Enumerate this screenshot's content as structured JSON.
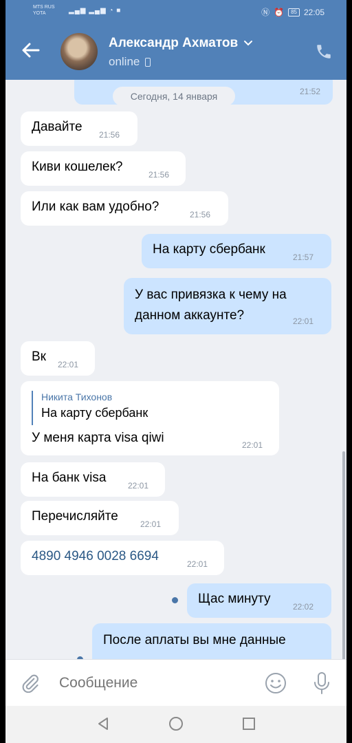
{
  "status_bar": {
    "carrier_line1": "MTS RUS",
    "carrier_line2": "YOTA",
    "battery": "85",
    "time": "22:05"
  },
  "header": {
    "contact_name": "Александр Ахматов",
    "status": "online",
    "accent_color": "#5181b8"
  },
  "date_separator": "Сегодня, 14 января",
  "top_partial_time": "21:52",
  "messages": [
    {
      "dir": "in",
      "text": "Давайте",
      "time": "21:56"
    },
    {
      "dir": "in",
      "text": "Киви кошелек?",
      "time": "21:56"
    },
    {
      "dir": "in",
      "text": "Или как вам удобно?",
      "time": "21:56"
    },
    {
      "dir": "out",
      "text": "На карту сбербанк",
      "time": "21:57"
    },
    {
      "dir": "out",
      "text_line1": "У вас привязка к чему  на",
      "text_line2": "данном аккаунте?",
      "time": "22:01"
    },
    {
      "dir": "in",
      "text": "Вк",
      "time": "22:01"
    },
    {
      "dir": "in",
      "reply_author": "Никита Тихонов",
      "reply_text": "На карту сбербанк",
      "text": "У меня карта visa qiwi",
      "time": "22:01"
    },
    {
      "dir": "in",
      "text": "На банк visa",
      "time": "22:01"
    },
    {
      "dir": "in",
      "text": "Перечисляйте",
      "time": "22:01"
    },
    {
      "dir": "in",
      "text": "4890 4946 0028 6694",
      "time": "22:01",
      "link_color": "#2a5885"
    },
    {
      "dir": "out",
      "text": "Щас минуту",
      "time": "22:02",
      "unread_dot": true
    },
    {
      "dir": "out",
      "text": "После аплаты вы мне данные",
      "unread_dot": true
    }
  ],
  "input": {
    "placeholder": "Сообщение"
  },
  "icons": [
    "back-arrow-icon",
    "chevron-down-icon",
    "phone-icon",
    "paperclip-icon",
    "smile-icon",
    "microphone-icon",
    "nav-back-icon",
    "nav-home-icon",
    "nav-recents-icon"
  ]
}
